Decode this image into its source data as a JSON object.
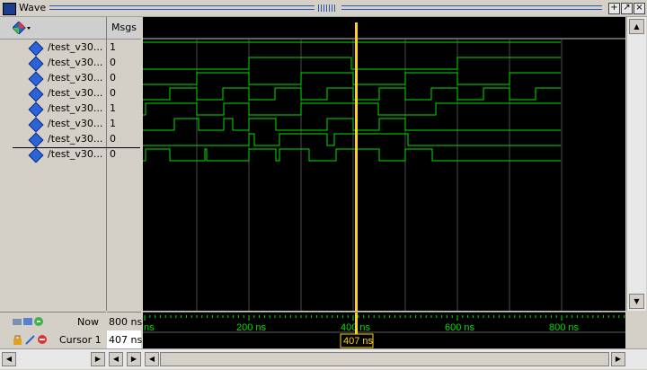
{
  "window": {
    "title": "Wave",
    "grip": "::::::"
  },
  "header": {
    "msgs_label": "Msgs"
  },
  "signals": [
    {
      "name": "/test_v30...",
      "value": "1"
    },
    {
      "name": "/test_v30...",
      "value": "0"
    },
    {
      "name": "/test_v30...",
      "value": "0"
    },
    {
      "name": "/test_v30...",
      "value": "0"
    },
    {
      "name": "/test_v30...",
      "value": "1"
    },
    {
      "name": "/test_v30...",
      "value": "1"
    },
    {
      "name": "/test_v30...",
      "value": "0"
    },
    {
      "name": "/test_v30...",
      "value": "0"
    }
  ],
  "footer": {
    "now_label": "Now",
    "now_value": "800 ns",
    "cursor_label": "Cursor 1",
    "cursor_value": "407 ns",
    "cursor_readout": "407 ns",
    "ticks": [
      "ns",
      "200 ns",
      "400 ns",
      "600 ns",
      "800 ns"
    ]
  },
  "colors": {
    "wave": "#00e000",
    "cursor": "#ffd11a",
    "grid": "#4a4a4a",
    "background": "#000000"
  }
}
